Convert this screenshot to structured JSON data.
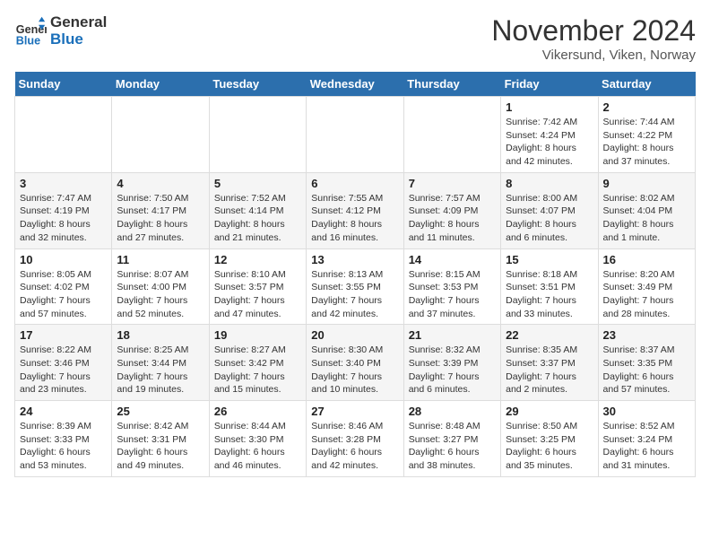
{
  "header": {
    "logo_line1": "General",
    "logo_line2": "Blue",
    "month_title": "November 2024",
    "location": "Vikersund, Viken, Norway"
  },
  "days_of_week": [
    "Sunday",
    "Monday",
    "Tuesday",
    "Wednesday",
    "Thursday",
    "Friday",
    "Saturday"
  ],
  "weeks": [
    [
      {
        "day": "",
        "info": ""
      },
      {
        "day": "",
        "info": ""
      },
      {
        "day": "",
        "info": ""
      },
      {
        "day": "",
        "info": ""
      },
      {
        "day": "",
        "info": ""
      },
      {
        "day": "1",
        "info": "Sunrise: 7:42 AM\nSunset: 4:24 PM\nDaylight: 8 hours and 42 minutes."
      },
      {
        "day": "2",
        "info": "Sunrise: 7:44 AM\nSunset: 4:22 PM\nDaylight: 8 hours and 37 minutes."
      }
    ],
    [
      {
        "day": "3",
        "info": "Sunrise: 7:47 AM\nSunset: 4:19 PM\nDaylight: 8 hours and 32 minutes."
      },
      {
        "day": "4",
        "info": "Sunrise: 7:50 AM\nSunset: 4:17 PM\nDaylight: 8 hours and 27 minutes."
      },
      {
        "day": "5",
        "info": "Sunrise: 7:52 AM\nSunset: 4:14 PM\nDaylight: 8 hours and 21 minutes."
      },
      {
        "day": "6",
        "info": "Sunrise: 7:55 AM\nSunset: 4:12 PM\nDaylight: 8 hours and 16 minutes."
      },
      {
        "day": "7",
        "info": "Sunrise: 7:57 AM\nSunset: 4:09 PM\nDaylight: 8 hours and 11 minutes."
      },
      {
        "day": "8",
        "info": "Sunrise: 8:00 AM\nSunset: 4:07 PM\nDaylight: 8 hours and 6 minutes."
      },
      {
        "day": "9",
        "info": "Sunrise: 8:02 AM\nSunset: 4:04 PM\nDaylight: 8 hours and 1 minute."
      }
    ],
    [
      {
        "day": "10",
        "info": "Sunrise: 8:05 AM\nSunset: 4:02 PM\nDaylight: 7 hours and 57 minutes."
      },
      {
        "day": "11",
        "info": "Sunrise: 8:07 AM\nSunset: 4:00 PM\nDaylight: 7 hours and 52 minutes."
      },
      {
        "day": "12",
        "info": "Sunrise: 8:10 AM\nSunset: 3:57 PM\nDaylight: 7 hours and 47 minutes."
      },
      {
        "day": "13",
        "info": "Sunrise: 8:13 AM\nSunset: 3:55 PM\nDaylight: 7 hours and 42 minutes."
      },
      {
        "day": "14",
        "info": "Sunrise: 8:15 AM\nSunset: 3:53 PM\nDaylight: 7 hours and 37 minutes."
      },
      {
        "day": "15",
        "info": "Sunrise: 8:18 AM\nSunset: 3:51 PM\nDaylight: 7 hours and 33 minutes."
      },
      {
        "day": "16",
        "info": "Sunrise: 8:20 AM\nSunset: 3:49 PM\nDaylight: 7 hours and 28 minutes."
      }
    ],
    [
      {
        "day": "17",
        "info": "Sunrise: 8:22 AM\nSunset: 3:46 PM\nDaylight: 7 hours and 23 minutes."
      },
      {
        "day": "18",
        "info": "Sunrise: 8:25 AM\nSunset: 3:44 PM\nDaylight: 7 hours and 19 minutes."
      },
      {
        "day": "19",
        "info": "Sunrise: 8:27 AM\nSunset: 3:42 PM\nDaylight: 7 hours and 15 minutes."
      },
      {
        "day": "20",
        "info": "Sunrise: 8:30 AM\nSunset: 3:40 PM\nDaylight: 7 hours and 10 minutes."
      },
      {
        "day": "21",
        "info": "Sunrise: 8:32 AM\nSunset: 3:39 PM\nDaylight: 7 hours and 6 minutes."
      },
      {
        "day": "22",
        "info": "Sunrise: 8:35 AM\nSunset: 3:37 PM\nDaylight: 7 hours and 2 minutes."
      },
      {
        "day": "23",
        "info": "Sunrise: 8:37 AM\nSunset: 3:35 PM\nDaylight: 6 hours and 57 minutes."
      }
    ],
    [
      {
        "day": "24",
        "info": "Sunrise: 8:39 AM\nSunset: 3:33 PM\nDaylight: 6 hours and 53 minutes."
      },
      {
        "day": "25",
        "info": "Sunrise: 8:42 AM\nSunset: 3:31 PM\nDaylight: 6 hours and 49 minutes."
      },
      {
        "day": "26",
        "info": "Sunrise: 8:44 AM\nSunset: 3:30 PM\nDaylight: 6 hours and 46 minutes."
      },
      {
        "day": "27",
        "info": "Sunrise: 8:46 AM\nSunset: 3:28 PM\nDaylight: 6 hours and 42 minutes."
      },
      {
        "day": "28",
        "info": "Sunrise: 8:48 AM\nSunset: 3:27 PM\nDaylight: 6 hours and 38 minutes."
      },
      {
        "day": "29",
        "info": "Sunrise: 8:50 AM\nSunset: 3:25 PM\nDaylight: 6 hours and 35 minutes."
      },
      {
        "day": "30",
        "info": "Sunrise: 8:52 AM\nSunset: 3:24 PM\nDaylight: 6 hours and 31 minutes."
      }
    ]
  ]
}
